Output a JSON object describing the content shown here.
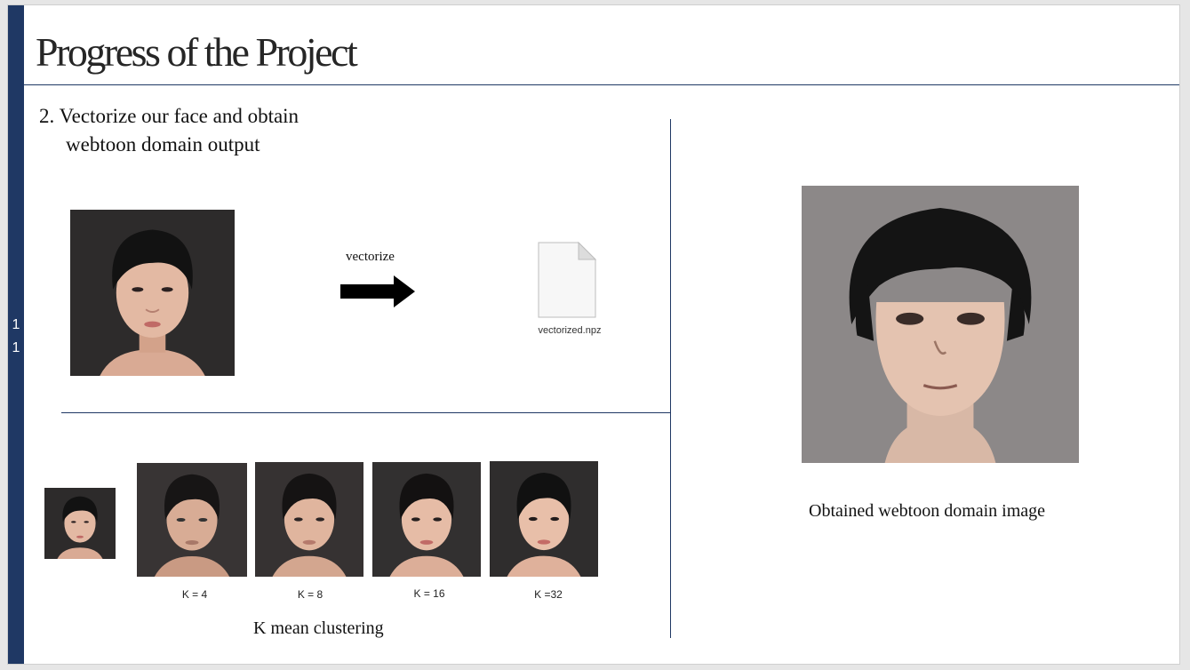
{
  "slide": {
    "number_digits": [
      "1",
      "1"
    ],
    "title": "Progress of the Project",
    "step_lines": [
      "2. Vectorize our face and obtain",
      "webtoon domain output"
    ],
    "vectorize_label": "vectorize",
    "file_name": "vectorized.npz",
    "k_labels": [
      "K = 4",
      "K = 8",
      "K = 16",
      "K =32"
    ],
    "left_caption": "K mean clustering",
    "right_caption": "Obtained webtoon domain image"
  },
  "colors": {
    "accent_bar": "#1f3864",
    "photo_background": "#2d2b2b",
    "webtoon_background": "#8c8888"
  }
}
